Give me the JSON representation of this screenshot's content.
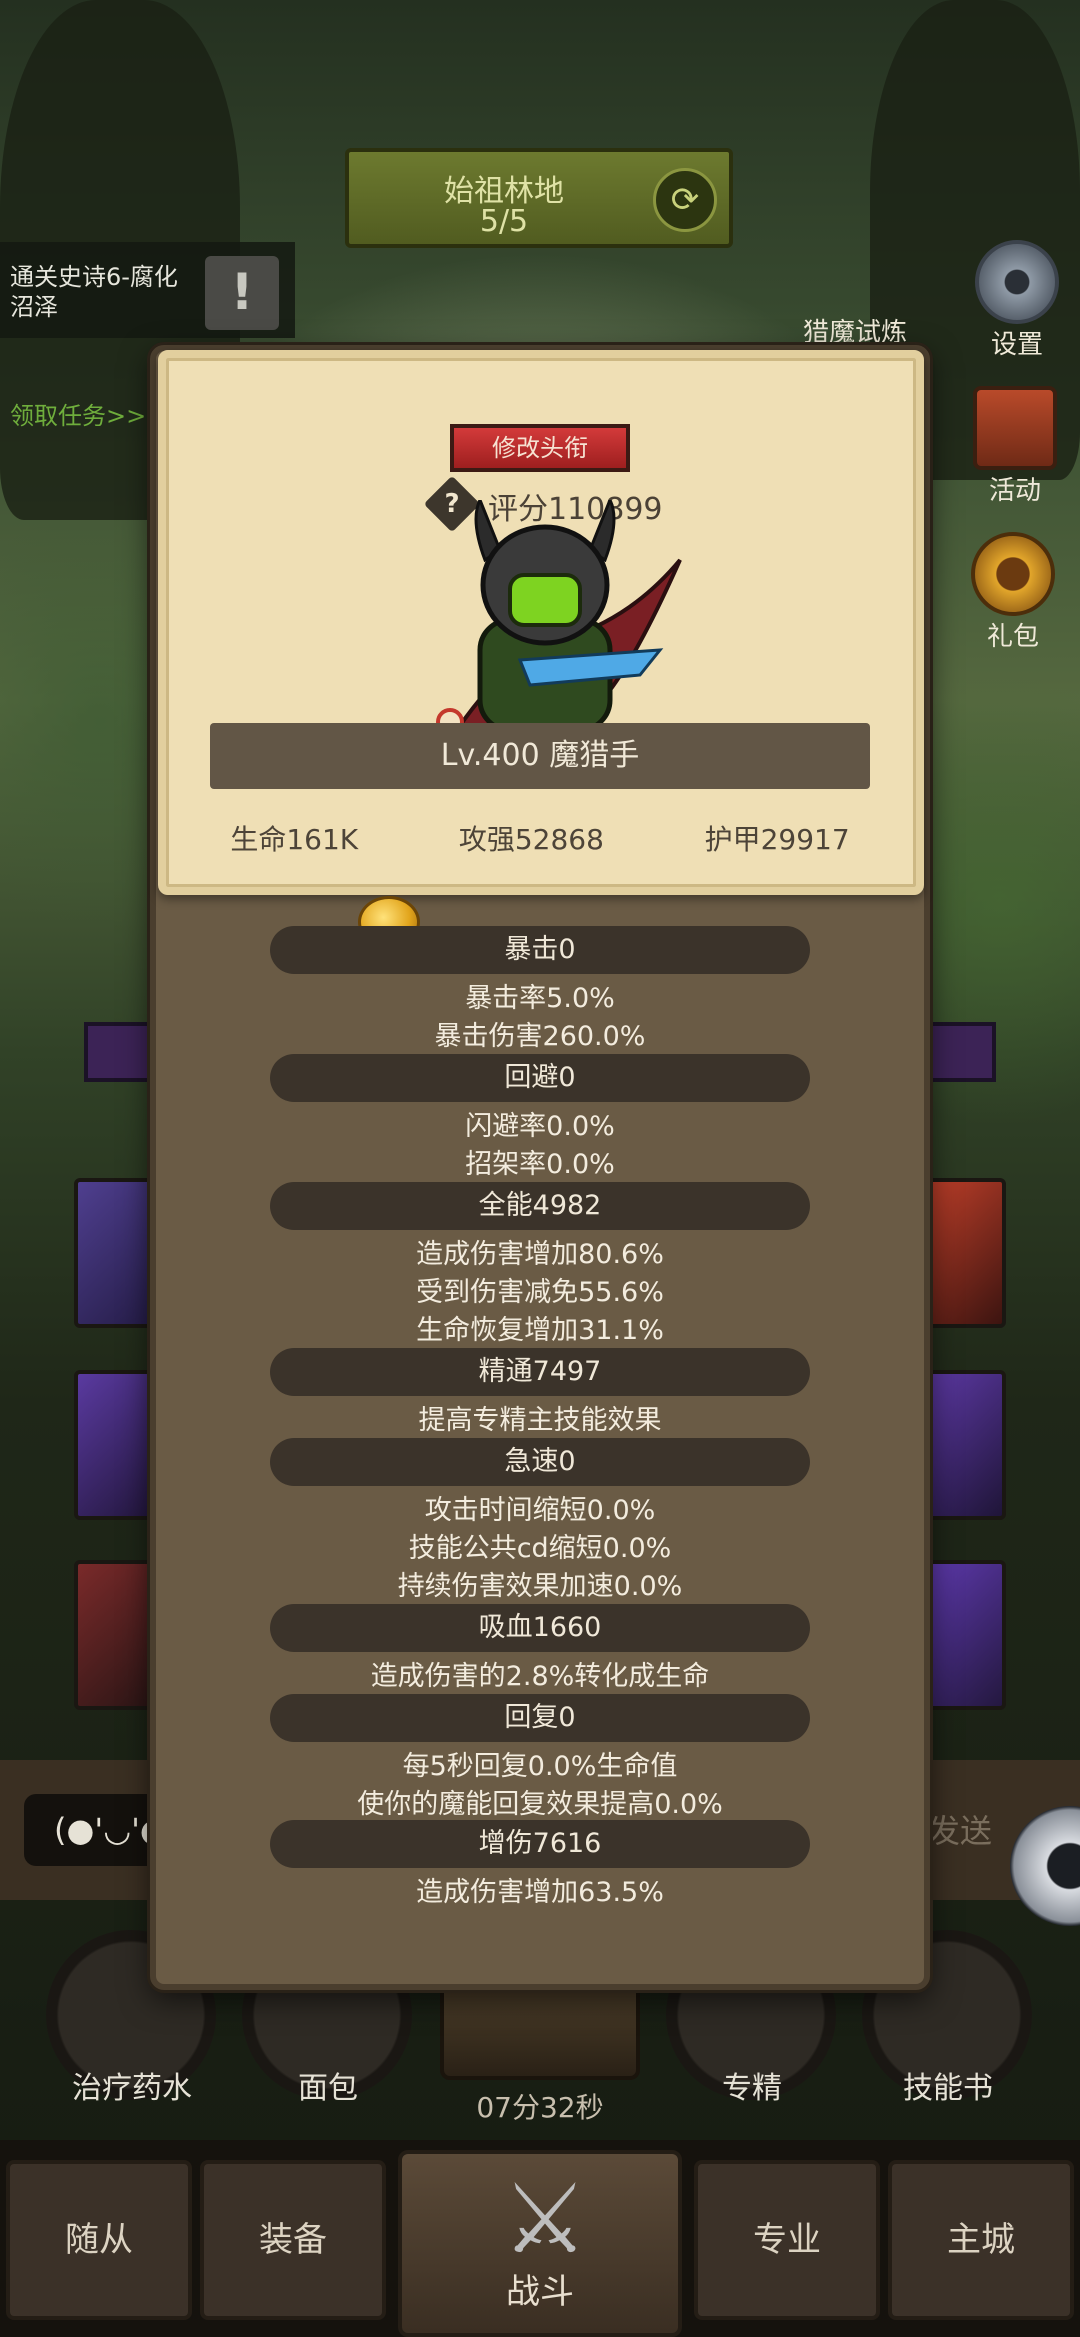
{
  "stage": {
    "name": "始祖林地",
    "progress": "5/5"
  },
  "quest": {
    "text": "通关史诗6-腐化沼泽",
    "link": "领取任务>>"
  },
  "side_buttons": {
    "hunt": "猎魔试炼",
    "settings": "设置",
    "activity": "活动",
    "gift": "礼包"
  },
  "panel": {
    "title_button": "修改头衔",
    "score": "评分110899",
    "name_banner": "Lv.400 魔猎手",
    "core": {
      "hp": "生命161K",
      "atk": "攻强52868",
      "armor": "护甲29917"
    },
    "sections": [
      {
        "header": "暴击0",
        "lines": [
          "暴击率5.0%",
          "暴击伤害260.0%"
        ]
      },
      {
        "header": "回避0",
        "lines": [
          "闪避率0.0%",
          "招架率0.0%"
        ]
      },
      {
        "header": "全能4982",
        "lines": [
          "造成伤害增加80.6%",
          "受到伤害减免55.6%",
          "生命恢复增加31.1%"
        ]
      },
      {
        "header": "精通7497",
        "lines": [
          "提高专精主技能效果"
        ]
      },
      {
        "header": "急速0",
        "lines": [
          "攻击时间缩短0.0%",
          "技能公共cd缩短0.0%",
          "持续伤害效果加速0.0%"
        ]
      },
      {
        "header": "吸血1660",
        "lines": [
          "造成伤害的2.8%转化成生命"
        ]
      },
      {
        "header": "回复0",
        "lines": [
          "每5秒回复0.0%生命值",
          "使你的魔能回复效果提高0.0%"
        ]
      },
      {
        "header": "增伤7616",
        "lines": [
          "造成伤害增加63.5%"
        ]
      }
    ]
  },
  "chat": {
    "emoji": "(●'◡'●",
    "send": "发送"
  },
  "items": {
    "potion": "治疗药水",
    "bread": "面包",
    "timer": "07分32秒",
    "spec": "专精",
    "skillbook": "技能书"
  },
  "nav": {
    "follower": "随从",
    "equip": "装备",
    "battle": "战斗",
    "profession": "专业",
    "city": "主城"
  },
  "colors": {
    "panel_bg": "#6a5b45",
    "card_bg": "#efdfb5",
    "header_pill": "#3b332a",
    "title_button": "#c62f2f"
  }
}
